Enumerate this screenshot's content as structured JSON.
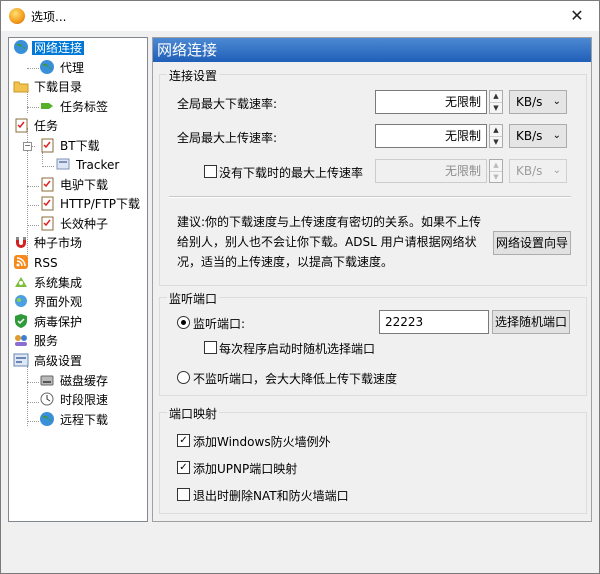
{
  "window": {
    "title": "选项...",
    "close_glyph": "✕"
  },
  "tree": {
    "items": [
      {
        "label": "网络连接",
        "icon": "globe-icon"
      },
      {
        "label": "代理",
        "icon": "globe-icon"
      },
      {
        "label": "下载目录",
        "icon": "folder-icon"
      },
      {
        "label": "任务标签",
        "icon": "tag-icon"
      },
      {
        "label": "任务",
        "icon": "task-icon"
      },
      {
        "label": "BT下载",
        "icon": "task-icon"
      },
      {
        "label": "Tracker",
        "icon": "tracker-icon"
      },
      {
        "label": "电驴下载",
        "icon": "task-icon"
      },
      {
        "label": "HTTP/FTP下载",
        "icon": "task-icon"
      },
      {
        "label": "长效种子",
        "icon": "task-icon"
      },
      {
        "label": "种子市场",
        "icon": "magnet-icon"
      },
      {
        "label": "RSS",
        "icon": "rss-icon"
      },
      {
        "label": "系统集成",
        "icon": "system-icon"
      },
      {
        "label": "界面外观",
        "icon": "appearance-icon"
      },
      {
        "label": "病毒保护",
        "icon": "shield-icon"
      },
      {
        "label": "服务",
        "icon": "service-icon"
      },
      {
        "label": "高级设置",
        "icon": "advanced-icon"
      },
      {
        "label": "磁盘缓存",
        "icon": "disk-icon"
      },
      {
        "label": "时段限速",
        "icon": "clock-icon"
      },
      {
        "label": "远程下载",
        "icon": "remote-icon"
      }
    ]
  },
  "panel": {
    "header": "网络连接",
    "conn": {
      "title": "连接设置",
      "max_down_label": "全局最大下载速率:",
      "max_down_value": "无限制",
      "max_down_unit": "KB/s",
      "max_up_label": "全局最大上传速率:",
      "max_up_value": "无限制",
      "max_up_unit": "KB/s",
      "no_task_label": "没有下载时的最大上传速率",
      "no_task_value": "无限制",
      "no_task_unit": "KB/s",
      "advice_line1": "建议:你的下载速度与上传速度有密切的关系。如果不上传",
      "advice_line2": "给别人，别人也不会让你下载。ADSL 用户请根据网络状",
      "advice_line3": "况，适当的上传速度，以提高下载速度。",
      "wizard_button": "网络设置向导"
    },
    "port": {
      "title": "监听端口",
      "listen_label": "监听端口:",
      "port_value": "22223",
      "random_button": "选择随机端口",
      "random_on_start": "每次程序启动时随机选择端口",
      "no_listen": "不监听端口，会大大降低上传下载速度"
    },
    "mapping": {
      "title": "端口映射",
      "firewall": "添加Windows防火墙例外",
      "upnp": "添加UPNP端口映射",
      "remove_on_exit": "退出时删除NAT和防火墙端口"
    },
    "spin_up": "▲",
    "spin_down": "▼",
    "dropdown_arrow": "⌄",
    "check_mark": "✓",
    "expander_minus": "−"
  }
}
